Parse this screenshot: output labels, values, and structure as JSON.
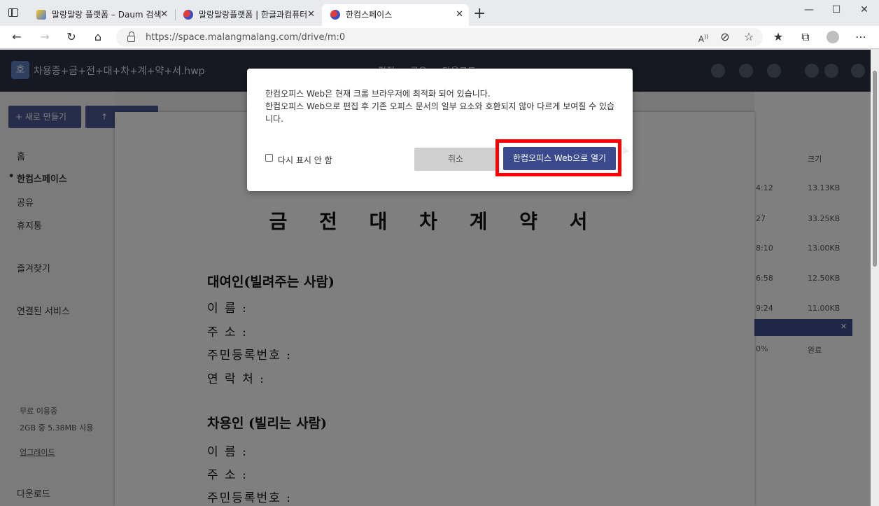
{
  "browser": {
    "tabs": [
      {
        "label": "말랑말랑 플랫폼 – Daum 검색",
        "active": false
      },
      {
        "label": "말랑말랑플랫폼 | 한글과컴퓨터",
        "active": false
      },
      {
        "label": "한컴스페이스",
        "active": true
      }
    ],
    "new_tab": "+",
    "url": "https://space.malangmalang.com/drive/m:0",
    "url_host": "space.malangmalang.com"
  },
  "app": {
    "file_name": "차용증+금+전+대+차+계+약+서.hwp",
    "logo_letter": "호",
    "menu": [
      "편집",
      "공유",
      "다운로드"
    ],
    "sidebar": {
      "new_button": "새로 만들기",
      "items": [
        "홈",
        "한컴스페이스",
        "공유",
        "휴지통",
        "즐겨찾기",
        "연결된 서비스"
      ],
      "selected": "한컴스페이스",
      "usage_title": "무료 이용중",
      "usage_text": "2GB 중 5.38MB 사용",
      "upgrade": "업그레이드",
      "download": "다운로드"
    },
    "file_list": {
      "size_header": "크기",
      "rows": [
        {
          "time": "4:12",
          "size": "13.13KB"
        },
        {
          "time": "27",
          "size": "33.25KB"
        },
        {
          "time": "8:10",
          "size": "13.00KB"
        },
        {
          "time": "6:58",
          "size": "12.50KB"
        },
        {
          "time": "9:24",
          "size": "11.00KB"
        }
      ],
      "progress_text": "0%",
      "done_label": "완료"
    }
  },
  "document": {
    "title": "금 전 대 차 계 약 서",
    "lender_heading": "대여인(빌려주는 사람)",
    "borrower_heading": "차용인 (빌리는 사람)",
    "fields": [
      "이          름 :",
      "주          소 :",
      "주민등록번호 :",
      "연     락     처 :"
    ],
    "borrower_fields": [
      "이          름 :",
      "주          소 :",
      "주민등록번호 :"
    ]
  },
  "modal": {
    "line1": "한컴오피스 Web은 현재 크롬 브라우저에 최적화 되어 있습니다.",
    "line2": "한컴오피스 Web으로 편집 후 기존 오피스 문서의 일부 요소와 호환되지 않아 다르게 보여질 수 있습니다.",
    "dont_show": "다시 표시 안 함",
    "cancel": "취소",
    "open": "한컴오피스 Web으로 열기"
  }
}
